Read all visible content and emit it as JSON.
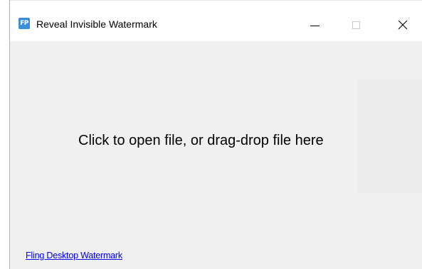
{
  "window": {
    "title": "Reveal Invisible Watermark",
    "icon": "app-logo-icon",
    "icon_text": "FP",
    "controls": {
      "minimize_icon": "minimize-icon",
      "maximize_icon": "maximize-icon",
      "close_icon": "close-icon",
      "close_glyph": "✕"
    }
  },
  "main": {
    "drop_prompt": "Click to open file, or drag-drop file here"
  },
  "footer": {
    "link_text": "Fling Desktop Watermark"
  },
  "colors": {
    "titlebar": "#ffffff",
    "client": "#f0f0f0",
    "link": "#0000ee",
    "app_icon": "#3a8fd6"
  }
}
